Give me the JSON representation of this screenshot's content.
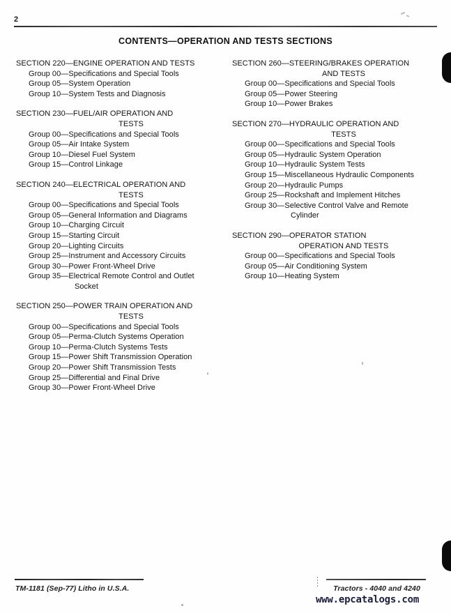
{
  "page": {
    "page_number": "2",
    "title": "CONTENTS—OPERATION AND TESTS SECTIONS"
  },
  "columns": {
    "left": [
      {
        "section_title": "SECTION 220—ENGINE OPERATION AND TESTS",
        "section_title_cont": "",
        "groups": [
          {
            "text": "Group 00—Specifications and Special Tools",
            "cont": ""
          },
          {
            "text": "Group 05—System Operation",
            "cont": ""
          },
          {
            "text": "Group 10—System Tests and Diagnosis",
            "cont": ""
          }
        ]
      },
      {
        "section_title": "SECTION 230—FUEL/AIR OPERATION AND",
        "section_title_cont": "TESTS",
        "groups": [
          {
            "text": "Group 00—Specifications and Special Tools",
            "cont": ""
          },
          {
            "text": "Group 05—Air Intake System",
            "cont": ""
          },
          {
            "text": "Group 10—Diesel Fuel System",
            "cont": ""
          },
          {
            "text": "Group 15—Control Linkage",
            "cont": ""
          }
        ]
      },
      {
        "section_title": "SECTION 240—ELECTRICAL OPERATION AND",
        "section_title_cont": "TESTS",
        "groups": [
          {
            "text": "Group 00—Specifications and Special Tools",
            "cont": ""
          },
          {
            "text": "Group 05—General Information and Diagrams",
            "cont": ""
          },
          {
            "text": "Group 10—Charging Circuit",
            "cont": ""
          },
          {
            "text": "Group 15—Starting Circuit",
            "cont": ""
          },
          {
            "text": "Group 20—Lighting Circuits",
            "cont": ""
          },
          {
            "text": "Group 25—Instrument and Accessory Circuits",
            "cont": ""
          },
          {
            "text": "Group 30—Power Front-Wheel Drive",
            "cont": ""
          },
          {
            "text": "Group 35—Electrical Remote Control and Outlet",
            "cont": "Socket"
          }
        ]
      },
      {
        "section_title": "SECTION 250—POWER TRAIN OPERATION AND",
        "section_title_cont": "TESTS",
        "groups": [
          {
            "text": "Group 00—Specifications and Special Tools",
            "cont": ""
          },
          {
            "text": "Group 05—Perma-Clutch Systems Operation",
            "cont": ""
          },
          {
            "text": "Group 10—Perma-Clutch Systems Tests",
            "cont": ""
          },
          {
            "text": "Group 15—Power Shift Transmission Operation",
            "cont": ""
          },
          {
            "text": "Group 20—Power Shift Transmission Tests",
            "cont": ""
          },
          {
            "text": "Group 25—Differential and Final Drive",
            "cont": ""
          },
          {
            "text": "Group 30—Power Front-Wheel Drive",
            "cont": ""
          }
        ]
      }
    ],
    "right": [
      {
        "section_title": "SECTION 260—STEERING/BRAKES OPERATION",
        "section_title_cont": "AND TESTS",
        "groups": [
          {
            "text": "Group 00—Specifications and Special Tools",
            "cont": ""
          },
          {
            "text": "Group 05—Power Steering",
            "cont": ""
          },
          {
            "text": "Group 10—Power Brakes",
            "cont": ""
          }
        ]
      },
      {
        "section_title": "SECTION 270—HYDRAULIC OPERATION AND",
        "section_title_cont": "TESTS",
        "groups": [
          {
            "text": "Group 00—Specifications and Special Tools",
            "cont": ""
          },
          {
            "text": "Group 05—Hydraulic System Operation",
            "cont": ""
          },
          {
            "text": "Group 10—Hydraulic System Tests",
            "cont": ""
          },
          {
            "text": "Group 15—Miscellaneous Hydraulic Components",
            "cont": ""
          },
          {
            "text": "Group 20—Hydraulic Pumps",
            "cont": ""
          },
          {
            "text": "Group 25—Rockshaft and Implement Hitches",
            "cont": ""
          },
          {
            "text": "Group 30—Selective Control Valve and Remote",
            "cont": "Cylinder"
          }
        ]
      },
      {
        "section_title": "SECTION 290—OPERATOR STATION",
        "section_title_cont": "OPERATION AND TESTS",
        "groups": [
          {
            "text": "Group 00—Specifications and Special Tools",
            "cont": ""
          },
          {
            "text": "Group 05—Air Conditioning System",
            "cont": ""
          },
          {
            "text": "Group 10—Heating System",
            "cont": ""
          }
        ]
      }
    ]
  },
  "footer": {
    "left": "TM-1181 (Sep-77) Litho in U.S.A.",
    "right": "Tractors - 4040 and 4240",
    "watermark": "www.epcatalogs.com"
  }
}
